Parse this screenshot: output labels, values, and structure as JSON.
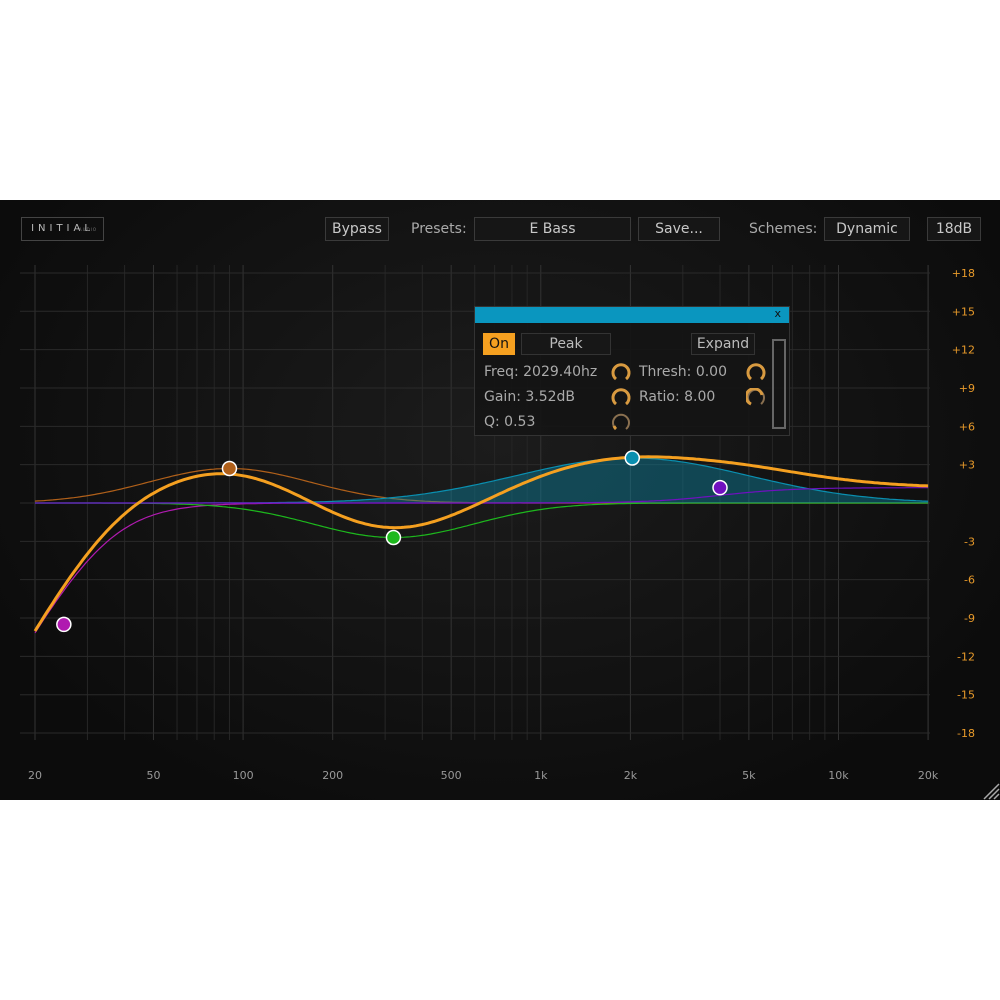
{
  "header": {
    "logo": "INITIAL",
    "logo_sub": "AUDIO",
    "bypass": "Bypass",
    "presets_label": "Presets:",
    "preset_value": "E Bass",
    "save": "Save...",
    "schemes_label": "Schemes:",
    "scheme_value": "Dynamic",
    "range": "18dB"
  },
  "y_ticks": [
    "+18",
    "+15",
    "+12",
    "+9",
    "+6",
    "+3",
    "-3",
    "-6",
    "-9",
    "-12",
    "-15",
    "-18"
  ],
  "x_ticks": [
    {
      "f": 20,
      "label": "20"
    },
    {
      "f": 50,
      "label": "50"
    },
    {
      "f": 100,
      "label": "100"
    },
    {
      "f": 200,
      "label": "200"
    },
    {
      "f": 500,
      "label": "500"
    },
    {
      "f": 1000,
      "label": "1k"
    },
    {
      "f": 2000,
      "label": "2k"
    },
    {
      "f": 5000,
      "label": "5k"
    },
    {
      "f": 10000,
      "label": "10k"
    },
    {
      "f": 20000,
      "label": "20k"
    }
  ],
  "bands": [
    {
      "type": "highpass",
      "freq": 25,
      "gain": -9.5,
      "color": "#b01ab0"
    },
    {
      "type": "peak",
      "freq": 90,
      "gain": 2.7,
      "color": "#b0601a"
    },
    {
      "type": "peak",
      "freq": 320,
      "gain": -2.7,
      "color": "#1db81d"
    },
    {
      "type": "peak",
      "freq": 2029.4,
      "gain": 3.52,
      "color": "#0a8fb0",
      "selected": true
    },
    {
      "type": "highshelf",
      "freq": 4000,
      "gain": 1.2,
      "color": "#7010c0"
    }
  ],
  "sum_color": "#f5a020",
  "panel": {
    "close": "x",
    "on": "On",
    "type": "Peak",
    "expand": "Expand",
    "freq": "Freq: 2029.40hz",
    "gain": "Gain: 3.52dB",
    "q": "Q: 0.53",
    "thresh": "Thresh: 0.00",
    "ratio": "Ratio: 8.00"
  }
}
